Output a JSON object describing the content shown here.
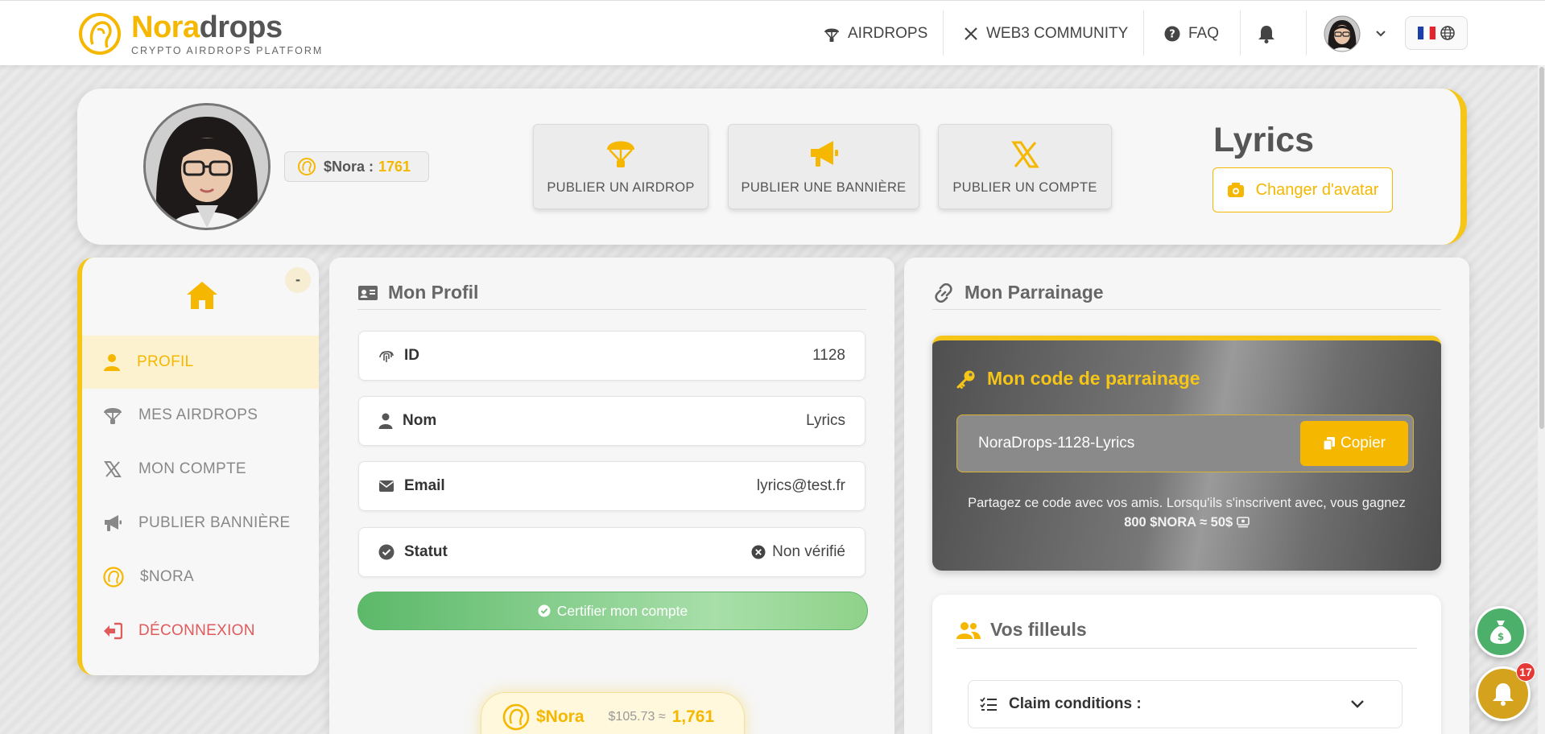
{
  "brand": {
    "name_part1": "Nora",
    "name_part2": "drops",
    "tagline": "CRYPTO AIRDROPS PLATFORM"
  },
  "nav": {
    "airdrops": "AIRDROPS",
    "community": "WEB3 COMMUNITY",
    "faq": "FAQ"
  },
  "hero": {
    "nora_label": "$Nora :",
    "nora_value": "1761",
    "publish_airdrop": "PUBLIER UN AIRDROP",
    "publish_banner": "PUBLIER UNE BANNIÈRE",
    "publish_account": "PUBLIER UN COMPTE",
    "username": "Lyrics",
    "change_avatar": "Changer d'avatar"
  },
  "sidebar": {
    "collapse": "-",
    "items": [
      {
        "label": "PROFIL"
      },
      {
        "label": "MES AIRDROPS"
      },
      {
        "label": "MON COMPTE"
      },
      {
        "label": "PUBLIER BANNIÈRE"
      },
      {
        "label": "$NORA"
      },
      {
        "label": "DÉCONNEXION"
      }
    ]
  },
  "profile": {
    "title": "Mon Profil",
    "fields": [
      {
        "label": "ID",
        "value": "1128"
      },
      {
        "label": "Nom",
        "value": "Lyrics"
      },
      {
        "label": "Email",
        "value": "lyrics@test.fr"
      },
      {
        "label": "Statut",
        "value": "Non vérifié"
      }
    ],
    "certify": "Certifier mon compte",
    "pill_label": "$Nora",
    "pill_usd": "$105.73 ≈",
    "pill_amount": "1,761"
  },
  "referral": {
    "title": "Mon Parrainage",
    "code_title": "Mon code de parrainage",
    "code": "NoraDrops-1128-Lyrics",
    "copy": "Copier",
    "text": "Partagez ce code avec vos amis. Lorsqu'ils s'inscrivent avec, vous gagnez",
    "reward": "800 $NORA ≈ 50$",
    "filleuls_title": "Vos filleuls",
    "claim": "Claim conditions :"
  },
  "notifications": {
    "count": "17"
  },
  "colors": {
    "accent": "#f5b700",
    "danger": "#e05a5a",
    "success": "#5cb96a"
  }
}
